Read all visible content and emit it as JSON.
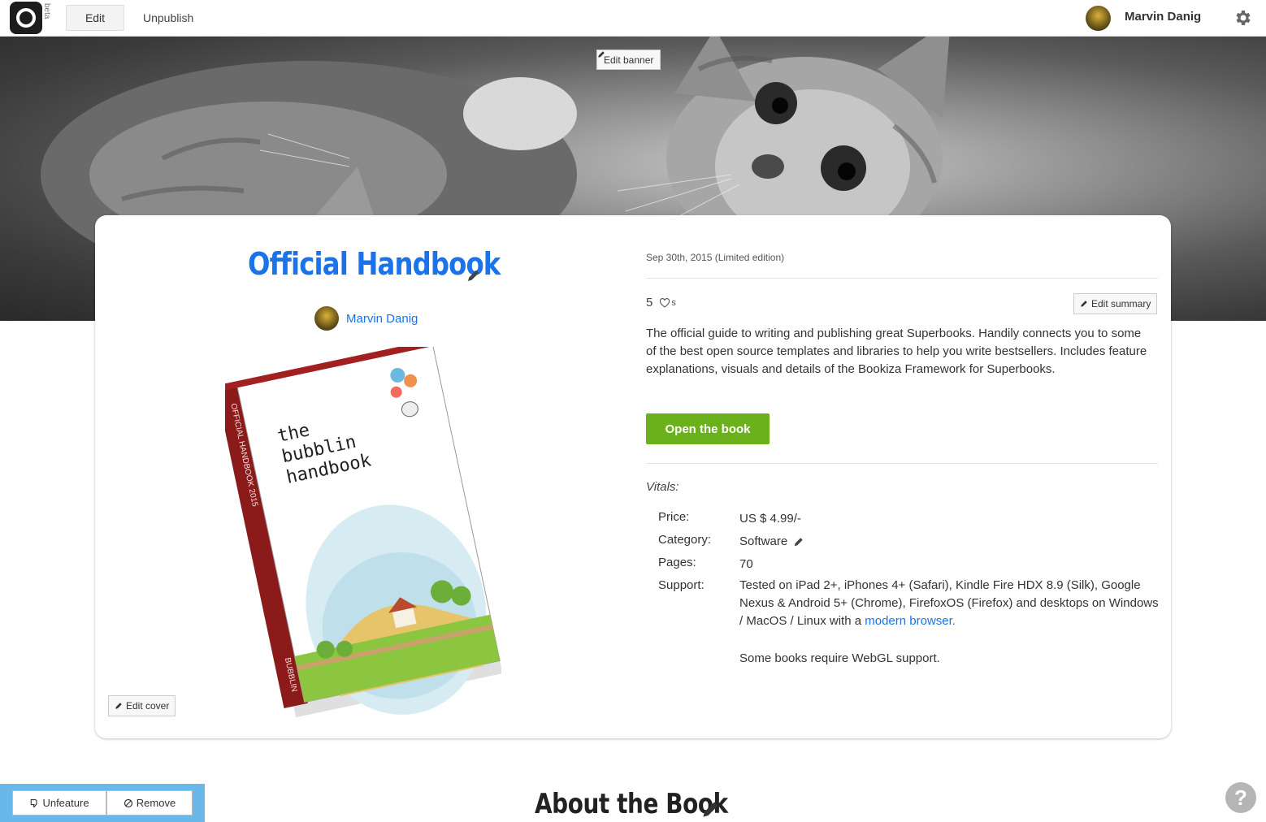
{
  "topbar": {
    "logo_badge": "beta",
    "edit_label": "Edit",
    "unpublish_label": "Unpublish",
    "user_name": "Marvin Danig"
  },
  "banner": {
    "edit_label": "Edit banner"
  },
  "book": {
    "title": "Official Handbook",
    "author": "Marvin Danig",
    "cover_title_line1": "the",
    "cover_title_line2": "bubblin",
    "cover_title_line3": "handbook",
    "cover_spine": "OFFICIAL HANDBOOK 2015",
    "cover_publisher": "BUBBLIN",
    "edit_cover_label": "Edit cover",
    "date": "Sep 30th, 2015 (Limited edition)",
    "likes_count": "5",
    "likes_suffix": "s",
    "edit_summary_label": "Edit summary",
    "summary": "The official guide to writing and publishing great Superbooks. Handily connects you to some of the best open source templates and libraries to help you write bestsellers. Includes feature explanations, visuals and details of the Bookiza Framework for Superbooks.",
    "open_label": "Open the book",
    "vitals_label": "Vitals:",
    "vitals": {
      "price_key": "Price:",
      "price_val": "US $ 4.99/-",
      "category_key": "Category:",
      "category_val": "Software",
      "pages_key": "Pages:",
      "pages_val": "70",
      "support_key": "Support:",
      "support_val": "Tested on iPad 2+, iPhones 4+ (Safari), Kindle Fire HDX 8.9 (Silk), Google Nexus & Android 5+ (Chrome), FirefoxOS (Firefox) and desktops on Windows / MacOS / Linux with a",
      "support_link": "modern browser.",
      "support_note": "Some books require WebGL support."
    }
  },
  "about": {
    "heading": "About the Book"
  },
  "feature_bar": {
    "unfeature_label": "Unfeature",
    "remove_label": "Remove"
  },
  "help": {
    "label": "?"
  },
  "colors": {
    "accent_blue": "#1a73e8",
    "open_button_green": "#6bb11c",
    "feature_bar_blue": "#6ab8ea",
    "cover_spine_red": "#8b1a1a"
  }
}
